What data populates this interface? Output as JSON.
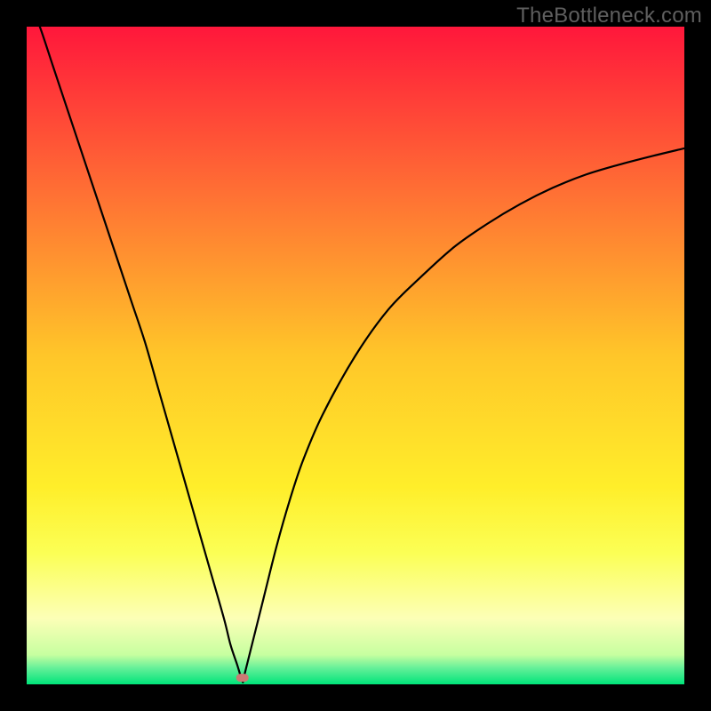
{
  "watermark": "TheBottleneck.com",
  "chart_data": {
    "type": "line",
    "title": "",
    "xlabel": "",
    "ylabel": "",
    "xlim": [
      0,
      100
    ],
    "ylim": [
      0,
      100
    ],
    "legend": false,
    "axes_visible": false,
    "background": {
      "type": "vertical-gradient",
      "stops": [
        {
          "pos": 0.0,
          "color": "#ff173b"
        },
        {
          "pos": 0.25,
          "color": "#ff6f34"
        },
        {
          "pos": 0.5,
          "color": "#ffc629"
        },
        {
          "pos": 0.7,
          "color": "#ffee2a"
        },
        {
          "pos": 0.8,
          "color": "#fbff55"
        },
        {
          "pos": 0.9,
          "color": "#fcffb7"
        },
        {
          "pos": 0.955,
          "color": "#c7ffa0"
        },
        {
          "pos": 0.975,
          "color": "#66f099"
        },
        {
          "pos": 1.0,
          "color": "#00e47a"
        }
      ]
    },
    "series": [
      {
        "name": "bottleneck-curve",
        "color": "#000000",
        "x": [
          0,
          2,
          4,
          6,
          8,
          10,
          12,
          14,
          16,
          18,
          20,
          22,
          24,
          26,
          28,
          30,
          31,
          32,
          32.8,
          33,
          34,
          36,
          38,
          40,
          42,
          45,
          50,
          55,
          60,
          65,
          70,
          75,
          80,
          85,
          90,
          95,
          100
        ],
        "y": [
          105,
          100,
          94,
          88,
          82,
          76,
          70,
          64,
          58,
          52,
          45,
          38,
          31,
          24,
          17,
          10,
          6,
          3,
          0.5,
          1,
          5,
          13,
          21,
          28,
          34,
          41,
          50,
          57,
          62,
          66.5,
          70,
          73,
          75.5,
          77.5,
          79,
          80.3,
          81.5
        ]
      }
    ],
    "marker": {
      "x": 32.8,
      "y": 1.0,
      "color": "#cb7b74",
      "shape": "rounded-rect"
    }
  }
}
